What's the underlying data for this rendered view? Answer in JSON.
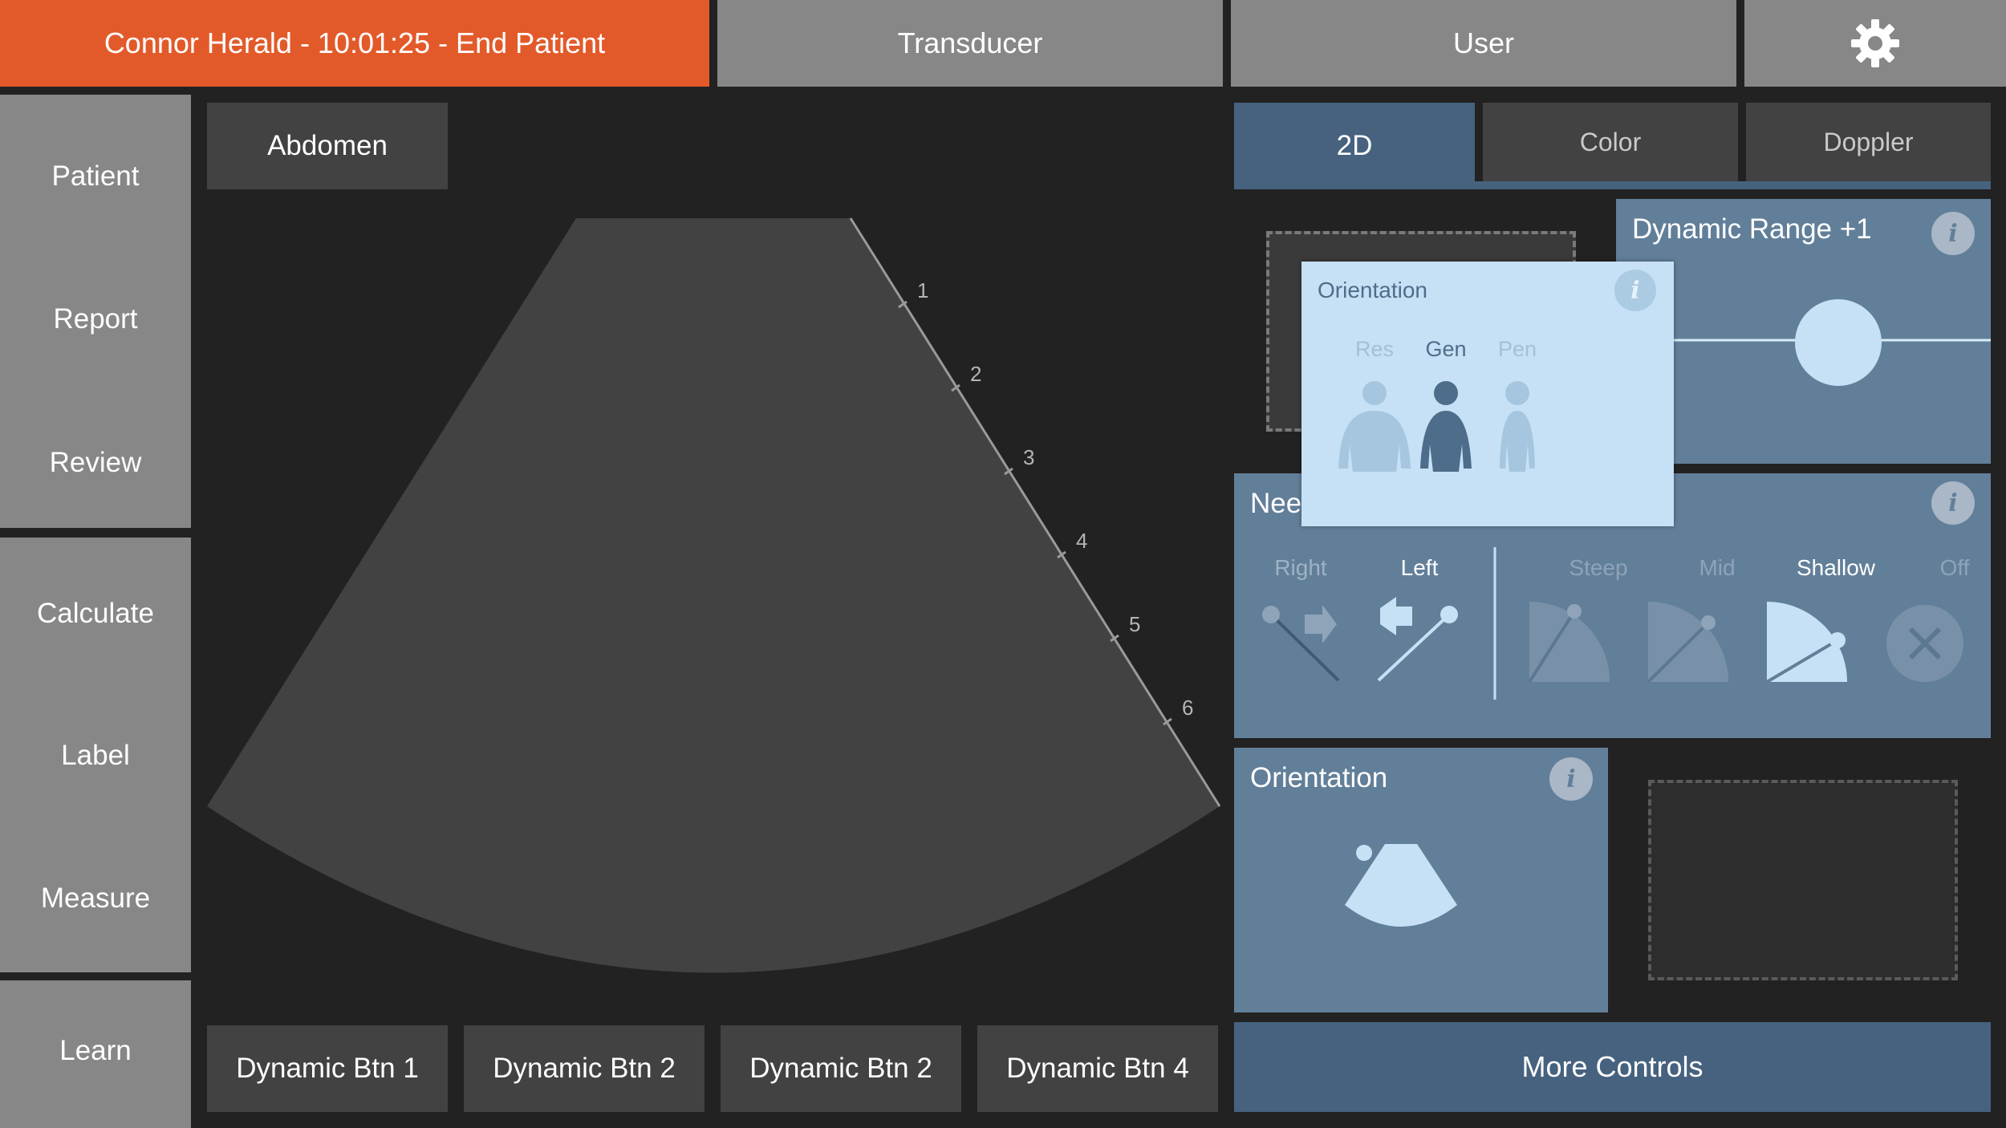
{
  "top_bar": {
    "patient_session": "Connor Herald - 10:01:25 - End Patient",
    "transducer": "Transducer",
    "user": "User",
    "settings_icon": "gear-icon"
  },
  "sidebar": {
    "items": [
      {
        "label": "Patient"
      },
      {
        "label": "Report"
      },
      {
        "label": "Review"
      },
      {
        "label": "Calculate"
      },
      {
        "label": "Label"
      },
      {
        "label": "Measure"
      },
      {
        "label": "Learn"
      }
    ]
  },
  "imaging": {
    "preset": "Abdomen",
    "depth_ticks": [
      "1",
      "2",
      "3",
      "4",
      "5",
      "6"
    ]
  },
  "dynamic_buttons": [
    "Dynamic Btn 1",
    "Dynamic Btn 2",
    "Dynamic Btn 2",
    "Dynamic Btn 4"
  ],
  "mode_tabs": {
    "active": "2D",
    "tabs": [
      {
        "label": "2D"
      },
      {
        "label": "Color"
      },
      {
        "label": "Doppler"
      }
    ]
  },
  "panels": {
    "dynamic_range": {
      "title": "Dynamic Range +1",
      "info": "i",
      "value_offset": 1
    },
    "needle": {
      "title": "Nee",
      "info": "i",
      "direction_options": [
        "Right",
        "Left"
      ],
      "direction_selected": "Left",
      "angle_options": [
        "Steep",
        "Mid",
        "Shallow",
        "Off"
      ],
      "angle_selected": "Shallow"
    },
    "orientation": {
      "title": "Orientation",
      "info": "i"
    },
    "more_controls": "More Controls"
  },
  "orientation_popup": {
    "title": "Orientation",
    "info": "i",
    "options": [
      "Res",
      "Gen",
      "Pen"
    ],
    "selected": "Gen"
  },
  "colors": {
    "accent_orange": "#e35a2a",
    "panel_blue": "#627f99",
    "active_blue": "#46627f",
    "popup_light": "#c6e1f5",
    "neutral_gray": "#878787"
  }
}
